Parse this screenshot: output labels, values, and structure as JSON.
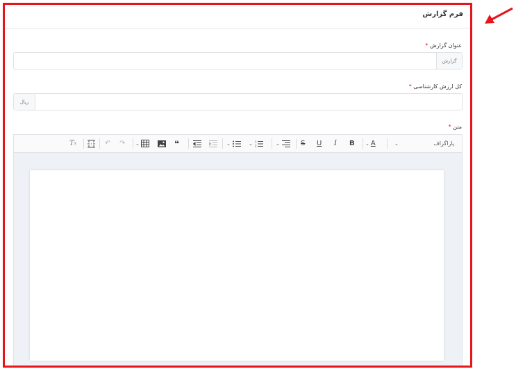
{
  "form": {
    "title": "فرم گزارش",
    "report_title": {
      "label": "عنوان گزارش",
      "required_mark": "*",
      "addon": "گزارش",
      "value": "",
      "placeholder": ""
    },
    "expert_value": {
      "label": "کل ارزش کارشناسی",
      "required_mark": "*",
      "addon": "ریال",
      "value": "",
      "placeholder": ""
    },
    "body": {
      "label": "متن",
      "required_mark": "*"
    }
  },
  "editor": {
    "heading_select": "پاراگراف",
    "toolbar_icons": [
      "heading-dropdown",
      "font-color",
      "bold",
      "italic",
      "underline",
      "strikethrough",
      "alignment",
      "numbered-list",
      "bulleted-list",
      "outdent",
      "indent",
      "block-quote",
      "insert-image",
      "insert-table",
      "undo",
      "redo",
      "page-break",
      "remove-format"
    ]
  },
  "colors": {
    "frame_border": "#e8141b",
    "arrow": "#e8141b",
    "required": "#e8141b",
    "editor_bg": "#eef1f6"
  }
}
